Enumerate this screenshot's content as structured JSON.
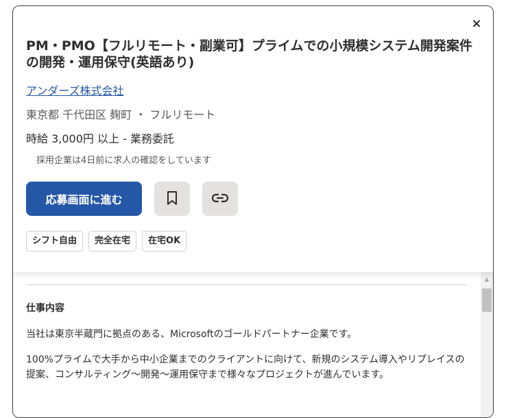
{
  "header": {
    "close_label": "×",
    "title": "PM・PMO【フルリモート・副業可】プライムでの小規模システム開発案件の開発・運用保守(英語あり)",
    "company": "アンダーズ株式会社",
    "location": "東京都 千代田区 麹町 ・ フルリモート",
    "salary": "時給 3,000円 以上 - 業務委託",
    "confirmation": "採用企業は4日前に求人の確認をしています",
    "apply_label": "応募画面に進む",
    "bookmark_icon": "bookmark-icon",
    "link_icon": "link-icon",
    "tags": [
      "シフト自由",
      "完全在宅",
      "在宅OK"
    ]
  },
  "body": {
    "section_title": "仕事内容",
    "paragraphs": [
      "当社は東京半蔵門に拠点のある、Microsoftのゴールドパートナー企業です。",
      "100%プライムで大手から中小企業までのクライアントに向けて、新規のシステム導入やリプレイスの提案、コンサルティング～開発～運用保守まで様々なプロジェクトが進んでいます。"
    ]
  },
  "colors": {
    "accent": "#2557a7",
    "icon_button_bg": "#e4e2e0",
    "text": "#2d2d2d",
    "muted": "#595959"
  }
}
